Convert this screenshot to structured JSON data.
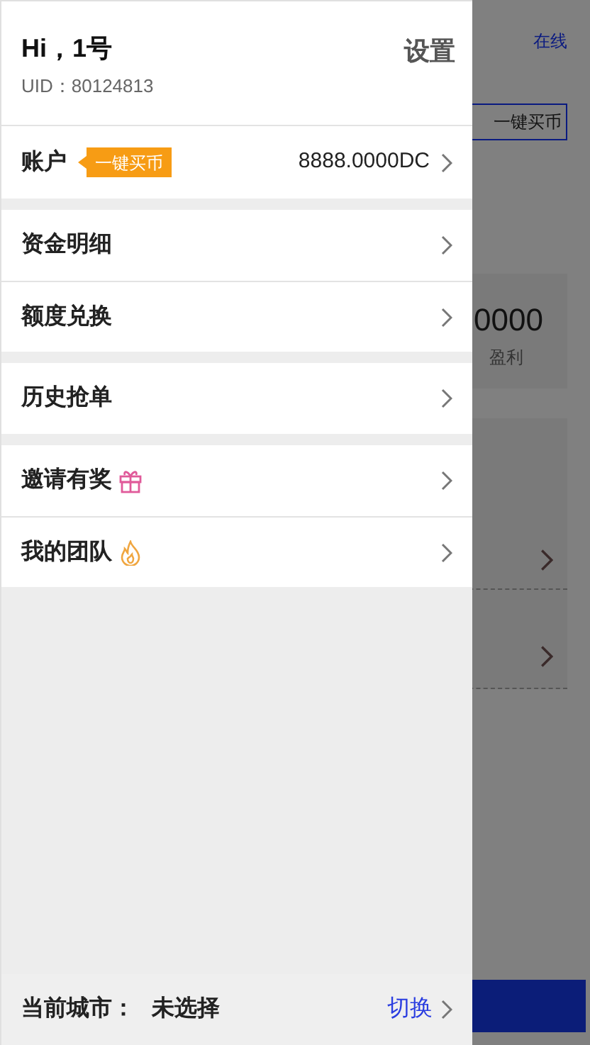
{
  "background_page": {
    "status": "在线",
    "buy_button": "一键买币",
    "stat_value": "0000",
    "stat_label": "盈利"
  },
  "drawer": {
    "greeting": "Hi，1号",
    "settings": "设置",
    "uid": "UID：80124813",
    "account": {
      "label": "账户",
      "badge": "一键买币",
      "balance": "8888.0000DC"
    },
    "groups": [
      [
        {
          "label": "资金明细",
          "kind": "plain"
        },
        {
          "label": "额度兑换",
          "kind": "plain"
        }
      ],
      [
        {
          "label": "历史抢单",
          "kind": "plain"
        }
      ],
      [
        {
          "label": "邀请有奖",
          "kind": "gift"
        },
        {
          "label": "我的团队",
          "kind": "flame"
        }
      ]
    ],
    "city": {
      "label": "当前城市：",
      "value": "未选择",
      "action": "切换"
    }
  }
}
